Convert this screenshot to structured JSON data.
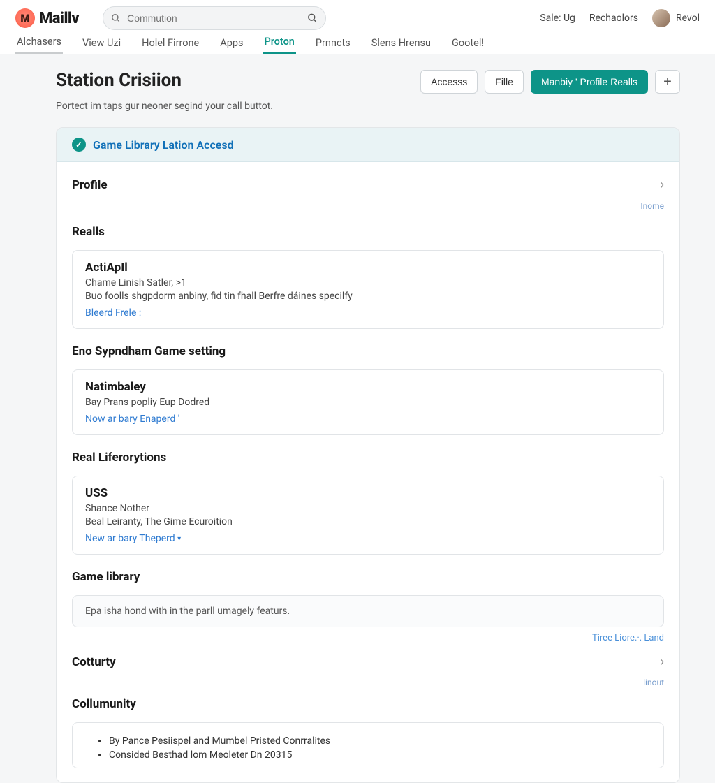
{
  "brand": {
    "name": "Maillv",
    "mark": "M"
  },
  "search": {
    "placeholder": "Commution"
  },
  "topbar_links": {
    "sale": "Sale: Ug",
    "rech": "Rechaolors",
    "user": "Revol"
  },
  "tabs": [
    {
      "label": "Alchasers"
    },
    {
      "label": "View Uzi"
    },
    {
      "label": "Holel Firrone"
    },
    {
      "label": "Apps"
    },
    {
      "label": "Proton"
    },
    {
      "label": "Prnncts"
    },
    {
      "label": "Slens Hrensu"
    },
    {
      "label": "Gootel!"
    }
  ],
  "page": {
    "title": "Station Crisiion",
    "subtitle": "Portect im taps gur neoner segind your call buttot.",
    "actions": {
      "access": "Accesss",
      "file": "Fille",
      "primary": "Manbiy ' Profile Realls",
      "plus": "+"
    }
  },
  "banner": {
    "text": "Game Library Lation Accesd"
  },
  "profile": {
    "title": "Profile",
    "side": "Inome"
  },
  "reails": {
    "title": "Realls",
    "card": {
      "heading": "ActiApIl",
      "line1": "Chame Linish Satler, >1",
      "line2": "Buo foolls shgpdorm anbiny, fid tin fhall Berfre dáines specilfy",
      "link": "Bleerd Frele :"
    }
  },
  "gamesetting": {
    "title": "Eno Sypndham Game setting",
    "card": {
      "heading": "Natimbaley",
      "line1": "Bay Prans popliy Eup Dodred",
      "link": "Now ar bary Enaperd '"
    }
  },
  "real_lif": {
    "title": "Real Liferorytions",
    "card": {
      "heading": "USS",
      "line1": "Shance Nother",
      "line2": "Beal Leiranty, The Gime Ecuroition",
      "link": "New ar bary Theperd"
    }
  },
  "gamelib": {
    "title": "Game library",
    "info": "Epa isha hond with in the parll umagely featurs.",
    "rightlink": "Tiree Liore.·. Land"
  },
  "cotturty": {
    "title": "Cotturty",
    "side": "linout"
  },
  "community": {
    "title": "Collumunity",
    "items": [
      "By Pance Pesiispel and Mumbel Pristed Conrralites",
      "Consided Besthad lom Meoleter Dn 20315"
    ]
  }
}
